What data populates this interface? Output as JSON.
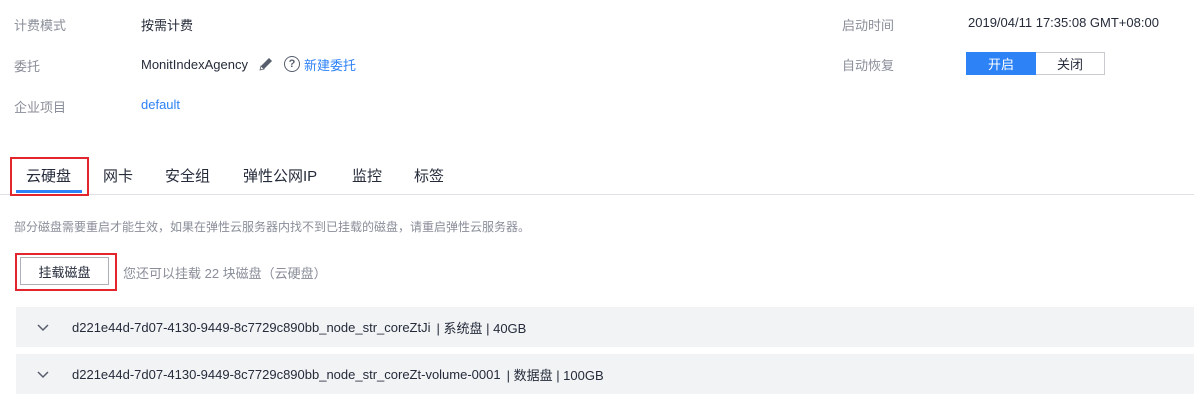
{
  "details": {
    "billing_mode": {
      "label": "计费模式",
      "value": "按需计费"
    },
    "agency": {
      "label": "委托",
      "value": "MonitIndexAgency",
      "new_link": "新建委托"
    },
    "enterprise_project": {
      "label": "企业项目",
      "value": "default"
    },
    "launch_time": {
      "label": "启动时间",
      "value": "2019/04/11 17:35:08 GMT+08:00"
    },
    "auto_recovery": {
      "label": "自动恢复",
      "on_label": "开启",
      "off_label": "关闭",
      "selected": "开启"
    }
  },
  "tabs": [
    {
      "label": "云硬盘",
      "active": true
    },
    {
      "label": "网卡"
    },
    {
      "label": "安全组"
    },
    {
      "label": "弹性公网IP"
    },
    {
      "label": "监控"
    },
    {
      "label": "标签"
    }
  ],
  "disks_panel": {
    "hint": "部分磁盘需要重启才能生效，如果在弹性云服务器内找不到已挂载的磁盘，请重启弹性云服务器。",
    "mount_button": "挂载磁盘",
    "mount_note": "您还可以挂载 22 块磁盘（云硬盘）",
    "disks": [
      {
        "name": "d221e44d-7d07-4130-9449-8c7729c890bb_node_str_coreZtJi",
        "meta": "| 系统盘 | 40GB"
      },
      {
        "name": "d221e44d-7d07-4130-9449-8c7729c890bb_node_str_coreZt-volume-0001",
        "meta": "| 数据盘 | 100GB"
      }
    ]
  },
  "colors": {
    "accent": "#2d82f6",
    "highlight": "#e3262b"
  }
}
